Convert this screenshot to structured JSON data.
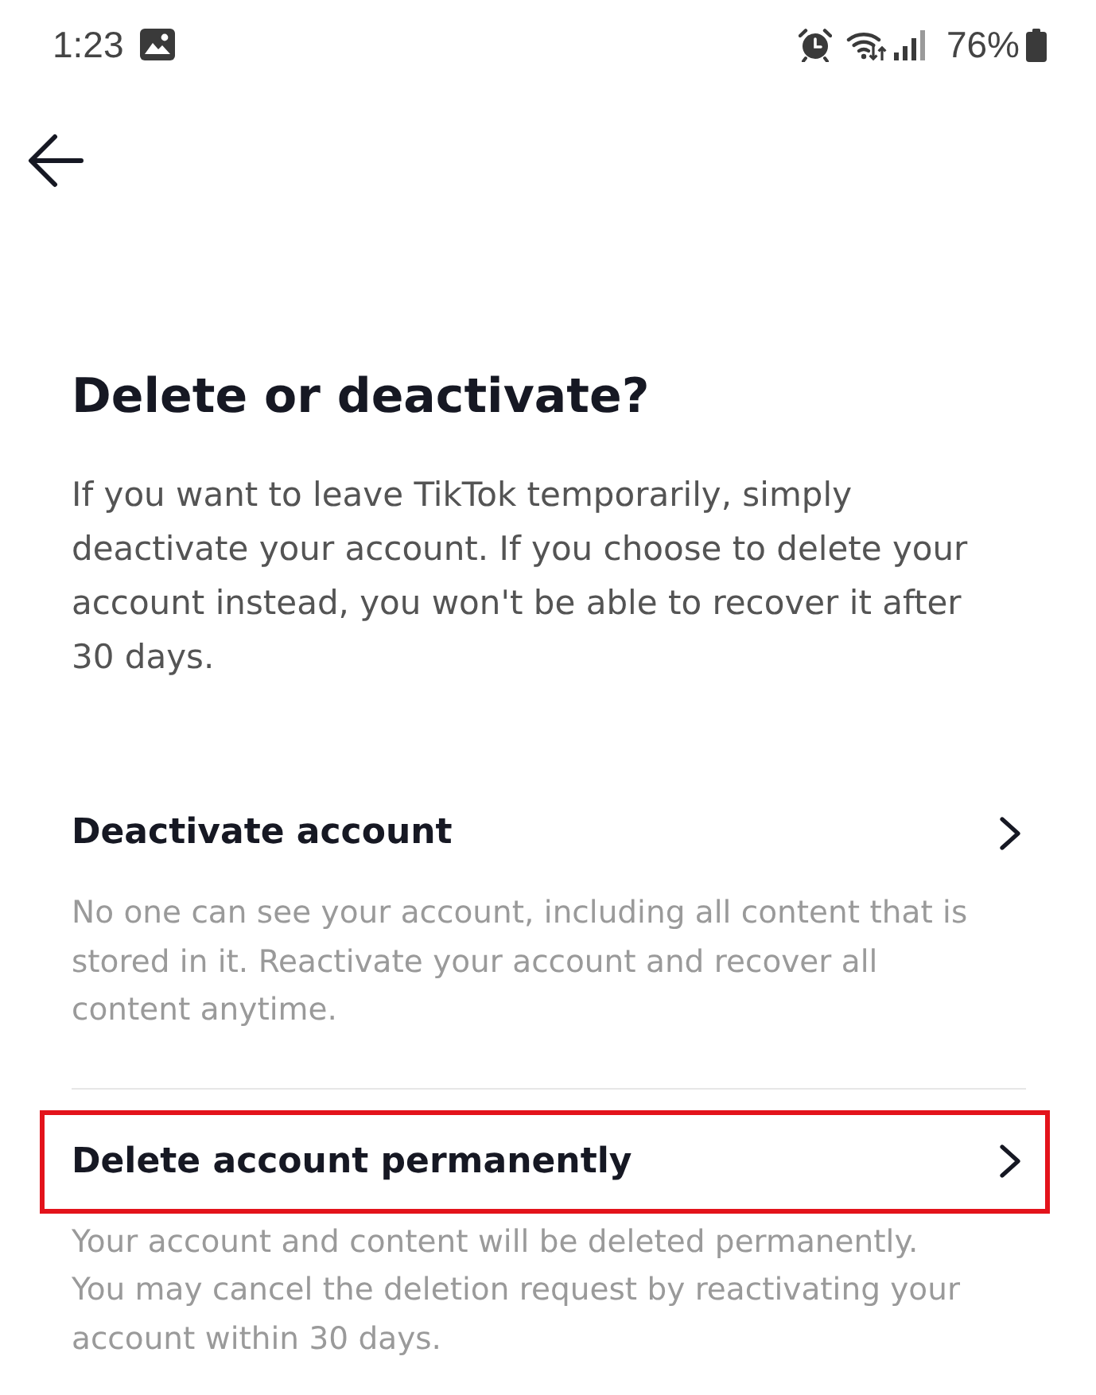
{
  "status_bar": {
    "time": "1:23",
    "battery": "76%"
  },
  "page": {
    "title": "Delete or deactivate?",
    "intro": "If you want to leave TikTok temporarily, simply deactivate your account. If you choose to delete your account instead, you won't be able to recover it after 30 days."
  },
  "options": [
    {
      "label": "Deactivate account",
      "description": "No one can see your account, including all content that is stored in it. Reactivate your account and recover all content anytime.",
      "highlighted": false
    },
    {
      "label": "Delete account permanently",
      "description": "Your account and content will be deleted permanently. You may cancel the deletion request by reactivating your account within 30 days.",
      "highlighted": true
    }
  ]
}
